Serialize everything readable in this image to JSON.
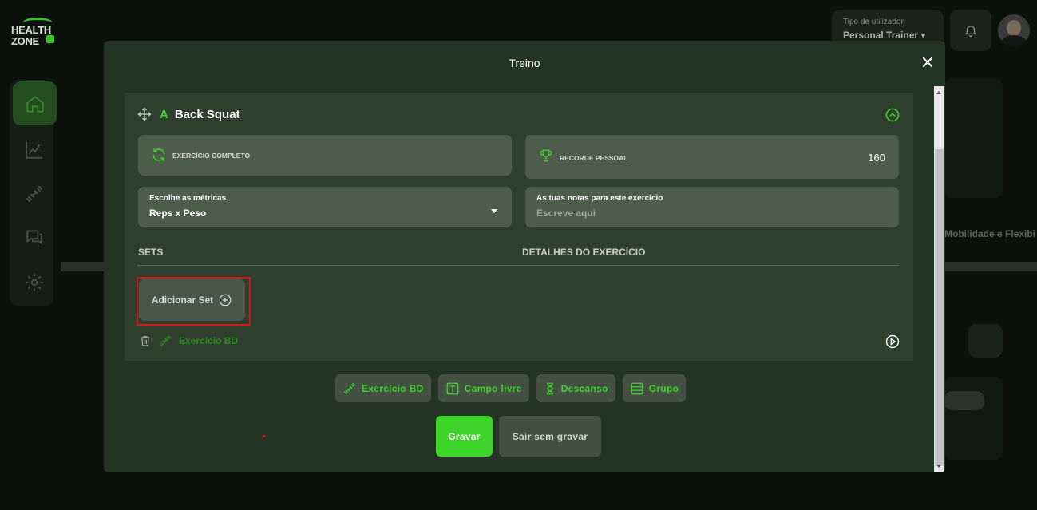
{
  "app": {
    "logo_line1": "HEALTH",
    "logo_line2": "ZONE"
  },
  "header": {
    "user_type_label": "Tipo de utilizador",
    "user_type_value": "Personal Trainer",
    "user_type_caret": "▾"
  },
  "background": {
    "tab_hint": "Mobilidade e Flexibi"
  },
  "modal": {
    "title": "Treino",
    "exercise": {
      "letter": "A",
      "name": "Back Squat"
    },
    "complete_label": "EXERCÍCIO COMPLETO",
    "record_label": "RECORDE PESSOAL",
    "record_value": "160",
    "metrics_label": "Escolhe as métricas",
    "metrics_value": "Reps x Peso",
    "notes_label": "As tuas notas para este exercício",
    "notes_placeholder": "Escreve aqui",
    "sets_header": "SETS",
    "details_header": "DETALHES DO EXERCÍCIO",
    "add_set_label": "Adicionar Set",
    "exercise_bd_link": "Exercício BD",
    "add_buttons": [
      {
        "label": "Exercício BD",
        "icon": "dumbbell-icon"
      },
      {
        "label": "Campo livre",
        "icon": "text-box-icon"
      },
      {
        "label": "Descanso",
        "icon": "hourglass-icon"
      },
      {
        "label": "Grupo",
        "icon": "list-group-icon"
      }
    ],
    "save_label": "Gravar",
    "exit_label": "Sair sem gravar"
  },
  "colors": {
    "accent": "#3ed52b",
    "modal_bg": "#243424",
    "card_bg": "#2f3f2e",
    "field_bg": "#4d5c4b",
    "highlight": "#d41818"
  }
}
